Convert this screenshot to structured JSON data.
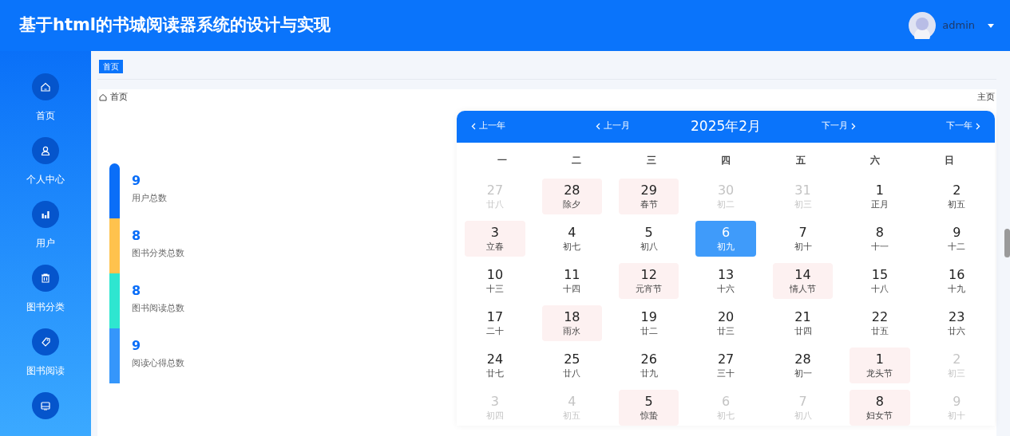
{
  "header": {
    "title": "基于html的书城阅读器系统的设计与实现",
    "user": "admin"
  },
  "sidebar": {
    "items": [
      {
        "label": "首页"
      },
      {
        "label": "个人中心"
      },
      {
        "label": "用户"
      },
      {
        "label": "图书分类"
      },
      {
        "label": "图书阅读"
      }
    ]
  },
  "tabs": [
    {
      "label": "首页",
      "selected": true
    }
  ],
  "breadcrumb": {
    "items": [
      "首页"
    ],
    "right": "主页"
  },
  "stats": [
    {
      "value": "9",
      "label": "用户总数",
      "color": "#0a6ef8"
    },
    {
      "value": "8",
      "label": "图书分类总数",
      "color": "#ffc24d"
    },
    {
      "value": "8",
      "label": "图书阅读总数",
      "color": "#2ee6d0"
    },
    {
      "value": "9",
      "label": "阅读心得总数",
      "color": "#3596fb"
    }
  ],
  "calendar": {
    "prev_year": "上一年",
    "prev_month": "上一月",
    "title": "2025年2月",
    "next_month": "下一月",
    "next_year": "下一年",
    "weekdays": [
      "一",
      "二",
      "三",
      "四",
      "五",
      "六",
      "日"
    ],
    "weeks": [
      [
        {
          "day": "27",
          "lunar": "廿八",
          "muted": true,
          "festival": false,
          "selected": false
        },
        {
          "day": "28",
          "lunar": "除夕",
          "muted": false,
          "festival": true,
          "selected": false
        },
        {
          "day": "29",
          "lunar": "春节",
          "muted": false,
          "festival": true,
          "selected": false
        },
        {
          "day": "30",
          "lunar": "初二",
          "muted": true,
          "festival": false,
          "selected": false
        },
        {
          "day": "31",
          "lunar": "初三",
          "muted": true,
          "festival": false,
          "selected": false
        },
        {
          "day": "1",
          "lunar": "正月",
          "muted": false,
          "festival": false,
          "selected": false
        },
        {
          "day": "2",
          "lunar": "初五",
          "muted": false,
          "festival": false,
          "selected": false
        }
      ],
      [
        {
          "day": "3",
          "lunar": "立春",
          "muted": false,
          "festival": true,
          "selected": false
        },
        {
          "day": "4",
          "lunar": "初七",
          "muted": false,
          "festival": false,
          "selected": false
        },
        {
          "day": "5",
          "lunar": "初八",
          "muted": false,
          "festival": false,
          "selected": false
        },
        {
          "day": "6",
          "lunar": "初九",
          "muted": false,
          "festival": false,
          "selected": true
        },
        {
          "day": "7",
          "lunar": "初十",
          "muted": false,
          "festival": false,
          "selected": false
        },
        {
          "day": "8",
          "lunar": "十一",
          "muted": false,
          "festival": false,
          "selected": false
        },
        {
          "day": "9",
          "lunar": "十二",
          "muted": false,
          "festival": false,
          "selected": false
        }
      ],
      [
        {
          "day": "10",
          "lunar": "十三",
          "muted": false,
          "festival": false,
          "selected": false
        },
        {
          "day": "11",
          "lunar": "十四",
          "muted": false,
          "festival": false,
          "selected": false
        },
        {
          "day": "12",
          "lunar": "元宵节",
          "muted": false,
          "festival": true,
          "selected": false
        },
        {
          "day": "13",
          "lunar": "十六",
          "muted": false,
          "festival": false,
          "selected": false
        },
        {
          "day": "14",
          "lunar": "情人节",
          "muted": false,
          "festival": true,
          "selected": false
        },
        {
          "day": "15",
          "lunar": "十八",
          "muted": false,
          "festival": false,
          "selected": false
        },
        {
          "day": "16",
          "lunar": "十九",
          "muted": false,
          "festival": false,
          "selected": false
        }
      ],
      [
        {
          "day": "17",
          "lunar": "二十",
          "muted": false,
          "festival": false,
          "selected": false
        },
        {
          "day": "18",
          "lunar": "雨水",
          "muted": false,
          "festival": true,
          "selected": false
        },
        {
          "day": "19",
          "lunar": "廿二",
          "muted": false,
          "festival": false,
          "selected": false
        },
        {
          "day": "20",
          "lunar": "廿三",
          "muted": false,
          "festival": false,
          "selected": false
        },
        {
          "day": "21",
          "lunar": "廿四",
          "muted": false,
          "festival": false,
          "selected": false
        },
        {
          "day": "22",
          "lunar": "廿五",
          "muted": false,
          "festival": false,
          "selected": false
        },
        {
          "day": "23",
          "lunar": "廿六",
          "muted": false,
          "festival": false,
          "selected": false
        }
      ],
      [
        {
          "day": "24",
          "lunar": "廿七",
          "muted": false,
          "festival": false,
          "selected": false
        },
        {
          "day": "25",
          "lunar": "廿八",
          "muted": false,
          "festival": false,
          "selected": false
        },
        {
          "day": "26",
          "lunar": "廿九",
          "muted": false,
          "festival": false,
          "selected": false
        },
        {
          "day": "27",
          "lunar": "三十",
          "muted": false,
          "festival": false,
          "selected": false
        },
        {
          "day": "28",
          "lunar": "初一",
          "muted": false,
          "festival": false,
          "selected": false
        },
        {
          "day": "1",
          "lunar": "龙头节",
          "muted": false,
          "festival": true,
          "selected": false
        },
        {
          "day": "2",
          "lunar": "初三",
          "muted": true,
          "festival": false,
          "selected": false
        }
      ],
      [
        {
          "day": "3",
          "lunar": "初四",
          "muted": true,
          "festival": false,
          "selected": false
        },
        {
          "day": "4",
          "lunar": "初五",
          "muted": true,
          "festival": false,
          "selected": false
        },
        {
          "day": "5",
          "lunar": "惊蛰",
          "muted": false,
          "festival": true,
          "selected": false
        },
        {
          "day": "6",
          "lunar": "初七",
          "muted": true,
          "festival": false,
          "selected": false
        },
        {
          "day": "7",
          "lunar": "初八",
          "muted": true,
          "festival": false,
          "selected": false
        },
        {
          "day": "8",
          "lunar": "妇女节",
          "muted": false,
          "festival": true,
          "selected": false
        },
        {
          "day": "9",
          "lunar": "初十",
          "muted": true,
          "festival": false,
          "selected": false
        }
      ]
    ]
  }
}
